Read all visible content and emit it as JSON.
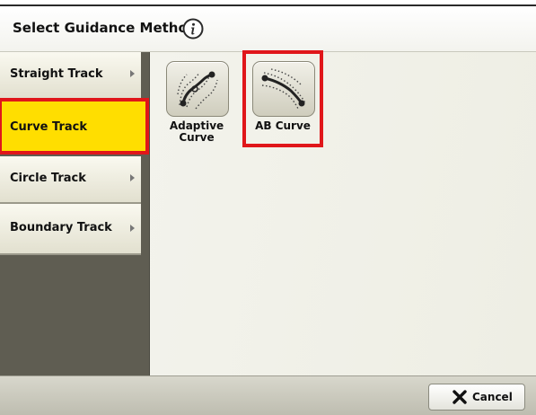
{
  "header": {
    "title": "Select Guidance Method",
    "info_icon": "info-icon"
  },
  "sidebar": {
    "items": [
      {
        "label": "Straight Track",
        "selected": false
      },
      {
        "label": "Curve Track",
        "selected": true
      },
      {
        "label": "Circle Track",
        "selected": false
      },
      {
        "label": "Boundary Track",
        "selected": false
      }
    ]
  },
  "methods": [
    {
      "label_line1": "Adaptive",
      "label_line2": "Curve",
      "icon": "adaptive-curve-icon"
    },
    {
      "label_line1": "AB Curve",
      "label_line2": "",
      "icon": "ab-curve-icon",
      "highlighted": true
    }
  ],
  "footer": {
    "cancel_label": "Cancel",
    "cancel_icon": "close-icon"
  },
  "colors": {
    "selected_bg": "#ffde00",
    "highlight": "#e0161a",
    "sidebar_bg": "#5f5d52"
  }
}
